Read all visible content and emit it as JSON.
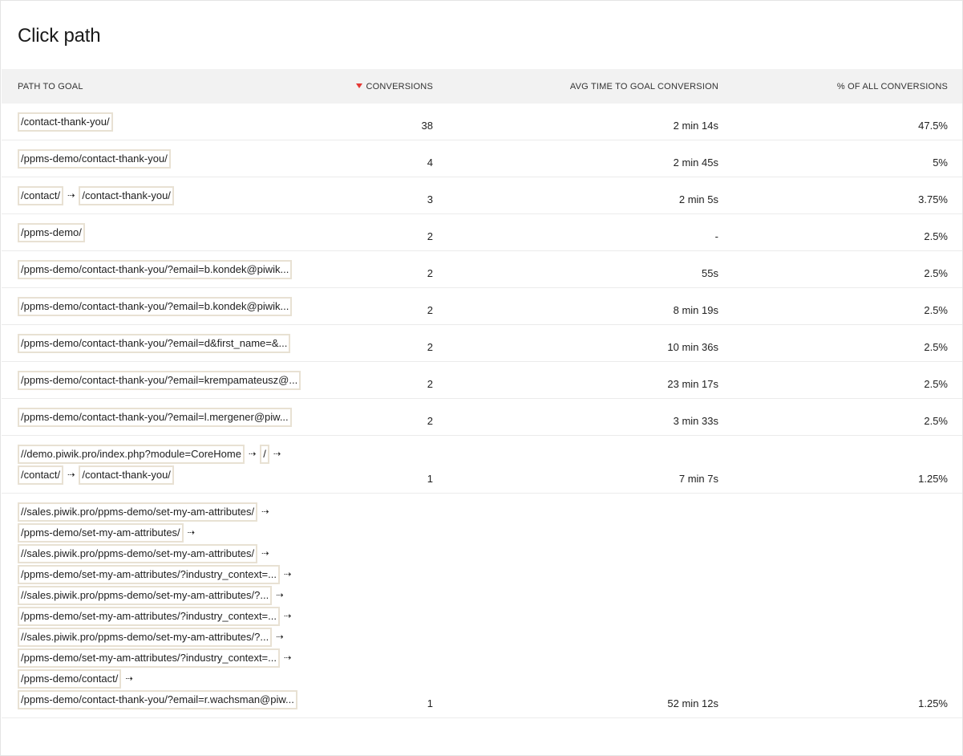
{
  "title": "Click path",
  "columns": {
    "path": "PATH TO GOAL",
    "conversions": "CONVERSIONS",
    "avg_time": "AVG TIME TO GOAL CONVERSION",
    "pct": "% OF ALL CONVERSIONS"
  },
  "sort": {
    "column": "conversions",
    "direction": "desc",
    "indicator_color": "#e53935"
  },
  "arrow_glyph": "⇢",
  "rows": [
    {
      "lines": [
        [
          "/contact-thank-you/"
        ]
      ],
      "conversions": "38",
      "avg_time": "2 min 14s",
      "pct": "47.5%"
    },
    {
      "lines": [
        [
          "/ppms-demo/contact-thank-you/"
        ]
      ],
      "conversions": "4",
      "avg_time": "2 min 45s",
      "pct": "5%"
    },
    {
      "lines": [
        [
          "/contact/",
          "/contact-thank-you/"
        ]
      ],
      "conversions": "3",
      "avg_time": "2 min 5s",
      "pct": "3.75%"
    },
    {
      "lines": [
        [
          "/ppms-demo/"
        ]
      ],
      "conversions": "2",
      "avg_time": "-",
      "pct": "2.5%"
    },
    {
      "lines": [
        [
          "/ppms-demo/contact-thank-you/?email=b.kondek@piwik..."
        ]
      ],
      "conversions": "2",
      "avg_time": "55s",
      "pct": "2.5%"
    },
    {
      "lines": [
        [
          "/ppms-demo/contact-thank-you/?email=b.kondek@piwik..."
        ]
      ],
      "conversions": "2",
      "avg_time": "8 min 19s",
      "pct": "2.5%"
    },
    {
      "lines": [
        [
          "/ppms-demo/contact-thank-you/?email=d&first_name=&..."
        ]
      ],
      "conversions": "2",
      "avg_time": "10 min 36s",
      "pct": "2.5%"
    },
    {
      "lines": [
        [
          "/ppms-demo/contact-thank-you/?email=krempamateusz@..."
        ]
      ],
      "conversions": "2",
      "avg_time": "23 min 17s",
      "pct": "2.5%"
    },
    {
      "lines": [
        [
          "/ppms-demo/contact-thank-you/?email=l.mergener@piw..."
        ]
      ],
      "conversions": "2",
      "avg_time": "3 min 33s",
      "pct": "2.5%"
    },
    {
      "lines": [
        [
          "//demo.piwik.pro/index.php?module=CoreHome",
          "/",
          ""
        ],
        [
          "/contact/",
          "/contact-thank-you/"
        ]
      ],
      "conversions": "1",
      "avg_time": "7 min 7s",
      "pct": "1.25%"
    },
    {
      "lines": [
        [
          "//sales.piwik.pro/ppms-demo/set-my-am-attributes/",
          ""
        ],
        [
          "/ppms-demo/set-my-am-attributes/",
          ""
        ],
        [
          "//sales.piwik.pro/ppms-demo/set-my-am-attributes/",
          ""
        ],
        [
          "/ppms-demo/set-my-am-attributes/?industry_context=...",
          ""
        ],
        [
          "//sales.piwik.pro/ppms-demo/set-my-am-attributes/?...",
          ""
        ],
        [
          "/ppms-demo/set-my-am-attributes/?industry_context=...",
          ""
        ],
        [
          "//sales.piwik.pro/ppms-demo/set-my-am-attributes/?...",
          ""
        ],
        [
          "/ppms-demo/set-my-am-attributes/?industry_context=...",
          ""
        ],
        [
          "/ppms-demo/contact/",
          ""
        ],
        [
          "/ppms-demo/contact-thank-you/?email=r.wachsman@piw..."
        ]
      ],
      "conversions": "1",
      "avg_time": "52 min 12s",
      "pct": "1.25%"
    }
  ]
}
